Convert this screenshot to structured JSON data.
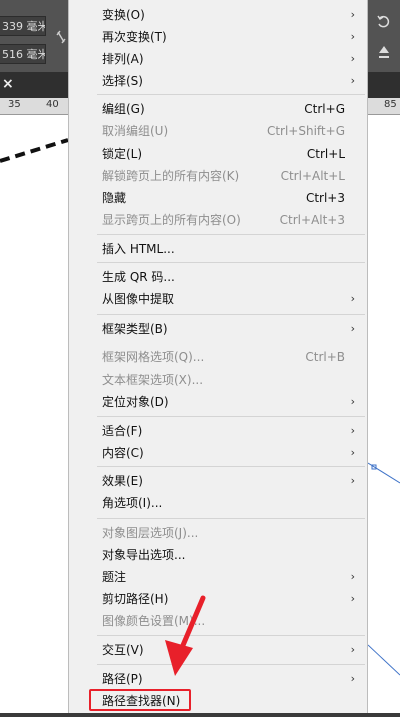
{
  "background": {
    "fields": [
      "339 毫米",
      "516 毫米"
    ],
    "ruler_left": [
      "35",
      "40"
    ],
    "ruler_right": "85",
    "tab_close": "×"
  },
  "menu": {
    "arrow_glyph": "›",
    "items": [
      {
        "label": "变换(O)",
        "shortcut": "",
        "submenu": true,
        "enabled": true
      },
      {
        "label": "再次变换(T)",
        "shortcut": "",
        "submenu": true,
        "enabled": true
      },
      {
        "label": "排列(A)",
        "shortcut": "",
        "submenu": true,
        "enabled": true
      },
      {
        "label": "选择(S)",
        "shortcut": "",
        "submenu": true,
        "enabled": true
      },
      {
        "label": "编组(G)",
        "shortcut": "Ctrl+G",
        "submenu": false,
        "enabled": true
      },
      {
        "label": "取消编组(U)",
        "shortcut": "Ctrl+Shift+G",
        "submenu": false,
        "enabled": false
      },
      {
        "label": "锁定(L)",
        "shortcut": "Ctrl+L",
        "submenu": false,
        "enabled": true
      },
      {
        "label": "解锁跨页上的所有内容(K)",
        "shortcut": "Ctrl+Alt+L",
        "submenu": false,
        "enabled": false
      },
      {
        "label": "隐藏",
        "shortcut": "Ctrl+3",
        "submenu": false,
        "enabled": true
      },
      {
        "label": "显示跨页上的所有内容(O)",
        "shortcut": "Ctrl+Alt+3",
        "submenu": false,
        "enabled": false
      },
      {
        "label": "插入 HTML...",
        "shortcut": "",
        "submenu": false,
        "enabled": true
      },
      {
        "label": "生成 QR 码...",
        "shortcut": "",
        "submenu": false,
        "enabled": true
      },
      {
        "label": "从图像中提取",
        "shortcut": "",
        "submenu": true,
        "enabled": true
      },
      {
        "label": "框架类型(B)",
        "shortcut": "",
        "submenu": true,
        "enabled": true
      },
      {
        "label": "框架网格选项(Q)...",
        "shortcut": "Ctrl+B",
        "submenu": false,
        "enabled": false
      },
      {
        "label": "文本框架选项(X)...",
        "shortcut": "",
        "submenu": false,
        "enabled": false
      },
      {
        "label": "定位对象(D)",
        "shortcut": "",
        "submenu": true,
        "enabled": true
      },
      {
        "label": "适合(F)",
        "shortcut": "",
        "submenu": true,
        "enabled": true
      },
      {
        "label": "内容(C)",
        "shortcut": "",
        "submenu": true,
        "enabled": true
      },
      {
        "label": "效果(E)",
        "shortcut": "",
        "submenu": true,
        "enabled": true
      },
      {
        "label": "角选项(I)...",
        "shortcut": "",
        "submenu": false,
        "enabled": true
      },
      {
        "label": "对象图层选项(J)...",
        "shortcut": "",
        "submenu": false,
        "enabled": false
      },
      {
        "label": "对象导出选项...",
        "shortcut": "",
        "submenu": false,
        "enabled": true
      },
      {
        "label": "题注",
        "shortcut": "",
        "submenu": true,
        "enabled": true
      },
      {
        "label": "剪切路径(H)",
        "shortcut": "",
        "submenu": true,
        "enabled": true
      },
      {
        "label": "图像颜色设置(M)...",
        "shortcut": "",
        "submenu": false,
        "enabled": false
      },
      {
        "label": "交互(V)",
        "shortcut": "",
        "submenu": true,
        "enabled": true
      },
      {
        "label": "路径(P)",
        "shortcut": "",
        "submenu": true,
        "enabled": true
      },
      {
        "label": "路径查找器(N)",
        "shortcut": "",
        "submenu": false,
        "enabled": true,
        "highlighted": true
      }
    ]
  },
  "colors": {
    "annotation_red": "#e8202a",
    "menu_bg": "#f0f0f0",
    "disabled_text": "#8e8e8e"
  }
}
